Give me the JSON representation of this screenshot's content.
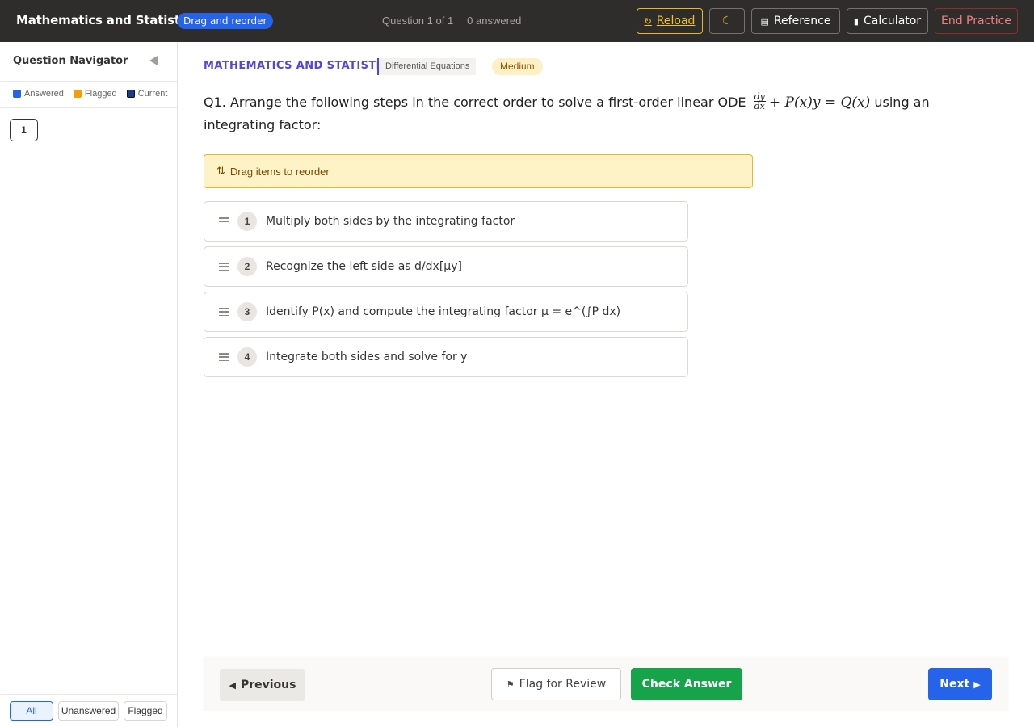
{
  "header": {
    "app_title": "Mathematics and Statistics",
    "mode_badge": "Drag and reorder",
    "question_counter": "Question 1 of 1",
    "answered_count": "0 answered",
    "reload_label": "Reload",
    "reference_label": "Reference",
    "calculator_label": "Calculator",
    "end_label": "End Practice"
  },
  "sidebar": {
    "title": "Question Navigator",
    "legend": {
      "answered": "Answered",
      "flagged": "Flagged",
      "current": "Current"
    },
    "question_numbers": [
      "1"
    ],
    "filters": {
      "all": "All",
      "unanswered": "Unanswered",
      "flagged": "Flagged"
    }
  },
  "question": {
    "subject": "MATHEMATICS AND STATISTICS",
    "topic": "Differential Equations",
    "difficulty": "Medium",
    "prefix": "Q1. Arrange the following steps in the correct order to solve a first-order linear ODE",
    "frac_num": "dy",
    "frac_den": "dx",
    "equation": "+ P(x)y = Q(x)",
    "suffix": "using an integrating factor:",
    "hint": "Drag items to reorder",
    "items": [
      {
        "index": "1",
        "text": "Multiply both sides by the integrating factor"
      },
      {
        "index": "2",
        "text": "Recognize the left side as d/dx[μy]"
      },
      {
        "index": "3",
        "text": "Identify P(x) and compute the integrating factor μ = e^(∫P dx)"
      },
      {
        "index": "4",
        "text": "Integrate both sides and solve for y"
      }
    ]
  },
  "footer": {
    "previous_label": "Previous",
    "flag_label": "Flag for Review",
    "check_label": "Check Answer",
    "next_label": "Next"
  },
  "colors": {
    "answered": "#2563eb",
    "flagged": "#f59e0b",
    "current": "#1e3a8a",
    "accent": "#4f46e5",
    "success": "#16a34a"
  }
}
